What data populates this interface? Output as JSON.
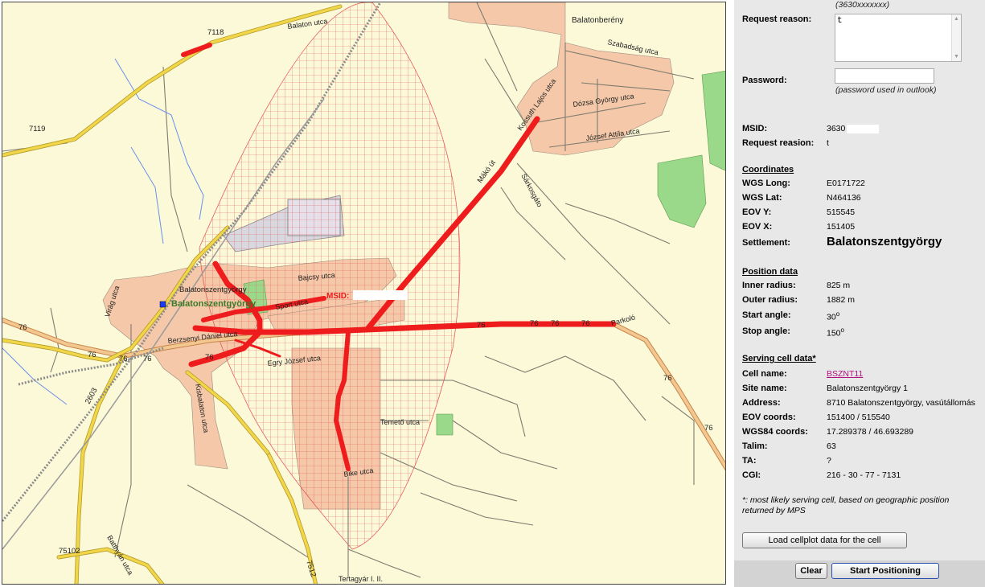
{
  "map": {
    "labels": {
      "balatonbereny": "Balatonberény",
      "szabadsag": "Szabadság utca",
      "balaton_utca": "Balaton utca",
      "r7118": "7118",
      "r7119": "7119",
      "kossuth": "Kossuth Lajos utca",
      "dozsa": "Dózsa György utca",
      "jozsef_attila": "József Attila utca",
      "mako": "Mákó út",
      "sarkosgato": "Sárkosgáto",
      "bajcsy": "Bajcsy utca",
      "sport": "Sport utca",
      "town_small": "Balatonszentgyörgy",
      "town_green": "Balatonszentgyörgy",
      "virag": "Virág utca",
      "berzsenyi": "Berzsenyi Dániel utca",
      "egry": "Egry József utca",
      "kisbalaton": "Kisbalaton utca",
      "temeto": "Temető utca",
      "bike": "Bike utca",
      "parkolo": "Parkoló",
      "r76": "76",
      "r7512": "7512",
      "r75102": "75102",
      "r2603": "2603",
      "batthyan": "Batthyán utca",
      "tertagyar": "Tertagyár I. II.",
      "msid_marker": "MSID:"
    }
  },
  "form": {
    "top_hint": "(3630xxxxxxx)",
    "reason_label": "Request reason:",
    "reason_value": "t",
    "password_label": "Password:",
    "password_hint": "(password used in outlook)"
  },
  "info": {
    "msid_label": "MSID:",
    "msid_value": "3630",
    "reason_label": "Request reasion:",
    "reason_value": "t"
  },
  "coordinates": {
    "title": "Coordinates",
    "wgs_long_label": "WGS Long:",
    "wgs_long": "E0171722",
    "wgs_lat_label": "WGS Lat:",
    "wgs_lat": "N464136",
    "eovy_label": "EOV Y:",
    "eovy": "515545",
    "eovx_label": "EOV X:",
    "eovx": "151405",
    "settlement_label": "Settlement:",
    "settlement": "Balatonszentgyörgy"
  },
  "position": {
    "title": "Position data",
    "inner_label": "Inner radius:",
    "inner": "825 m",
    "outer_label": "Outer radius:",
    "outer": "1882 m",
    "start_label": "Start angle:",
    "start": "30",
    "stop_label": "Stop angle:",
    "stop": "150",
    "degree": "o"
  },
  "serving": {
    "title": "Serving cell data*",
    "cell_label": "Cell name:",
    "cell": "BSZNT11",
    "site_label": "Site name:",
    "site": "Balatonszentgyörgy 1",
    "address_label": "Address:",
    "address": "8710 Balatonszentgyörgy, vasútállomás",
    "eov_label": "EOV coords:",
    "eov": "151400 / 515540",
    "wgs_label": "WGS84 coords:",
    "wgs": "17.289378 / 46.693289",
    "talim_label": "Talim:",
    "talim": "63",
    "ta_label": "TA:",
    "ta": "?",
    "cgi_label": "CGI:",
    "cgi": "216 - 30 - 77 - 7131",
    "footnote": "*: most likely serving cell, based on geographic position returned by MPS"
  },
  "buttons": {
    "load_cellplot": "Load cellplot data for the cell",
    "clear": "Clear",
    "start": "Start Positioning"
  },
  "colors": {
    "map_bg": "#fbf9d8",
    "urban": "#f4c8a8",
    "route": "#ee1c1c",
    "road_yellow": "#f2d64a",
    "road_orange": "#e8b070",
    "panel_bg": "#e8e8e8",
    "link": "#b0107f"
  }
}
